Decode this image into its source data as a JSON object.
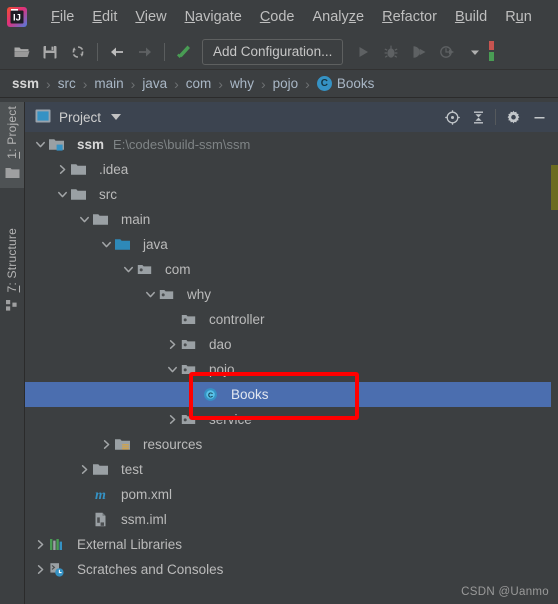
{
  "app": {
    "name": "IntelliJ IDEA",
    "logo_icon": "intellij-idea-logo"
  },
  "menubar": {
    "items": [
      {
        "label": "File",
        "mnemonic_index": 0
      },
      {
        "label": "Edit",
        "mnemonic_index": 0
      },
      {
        "label": "View",
        "mnemonic_index": 0
      },
      {
        "label": "Navigate",
        "mnemonic_index": 0
      },
      {
        "label": "Code",
        "mnemonic_index": 0
      },
      {
        "label": "Analyze",
        "mnemonic_index": 5
      },
      {
        "label": "Refactor",
        "mnemonic_index": 0
      },
      {
        "label": "Build",
        "mnemonic_index": 0
      },
      {
        "label": "Run",
        "mnemonic_index": 1
      }
    ]
  },
  "toolbar": {
    "open_icon": "open-folder-icon",
    "save_icon": "save-icon",
    "sync_icon": "sync-refresh-icon",
    "back_icon": "arrow-back-icon",
    "forward_icon": "arrow-forward-icon",
    "build_icon": "build-hammer-icon",
    "run_config_label": "Add Configuration...",
    "run_icon": "run-play-icon",
    "debug_icon": "debug-bug-icon",
    "coverage_icon": "run-with-coverage-icon",
    "profile_icon": "profiler-icon",
    "more_icon": "chevron-down-icon"
  },
  "breadcrumb": {
    "separator": "›",
    "items": [
      {
        "label": "ssm",
        "bold": true,
        "icon": null
      },
      {
        "label": "src",
        "bold": false,
        "icon": null
      },
      {
        "label": "main",
        "bold": false,
        "icon": null
      },
      {
        "label": "java",
        "bold": false,
        "icon": null
      },
      {
        "label": "com",
        "bold": false,
        "icon": null
      },
      {
        "label": "why",
        "bold": false,
        "icon": null
      },
      {
        "label": "pojo",
        "bold": false,
        "icon": null
      },
      {
        "label": "Books",
        "bold": false,
        "icon": "java-class-icon",
        "icon_letter": "C"
      }
    ]
  },
  "stripe": {
    "tabs": [
      {
        "label": "1: Project",
        "mnemonic": "1",
        "icon": "project-folder-icon",
        "active": true
      },
      {
        "label": "7: Structure",
        "mnemonic": "7",
        "icon": "structure-icon",
        "active": false
      }
    ]
  },
  "tool_window": {
    "title": "Project",
    "view_icon": "project-view-icon",
    "dropdown_icon": "chevron-down-icon",
    "actions": [
      {
        "name": "scroll-from-source-icon",
        "label": "Select Opened File"
      },
      {
        "name": "collapse-all-icon",
        "label": "Collapse All"
      },
      {
        "name": "gear-icon",
        "label": "Settings"
      },
      {
        "name": "minimize-icon",
        "label": "Hide"
      }
    ]
  },
  "tree": {
    "rows": [
      {
        "label": "ssm",
        "path": "E:\\codes\\build-ssm\\ssm",
        "depth": 0,
        "arrow": "expanded",
        "icon": "module-folder-icon",
        "bold": true,
        "selected": false
      },
      {
        "label": ".idea",
        "path": "",
        "depth": 1,
        "arrow": "collapsed",
        "icon": "folder-icon",
        "bold": false,
        "selected": false
      },
      {
        "label": "src",
        "path": "",
        "depth": 1,
        "arrow": "expanded",
        "icon": "folder-icon",
        "bold": false,
        "selected": false
      },
      {
        "label": "main",
        "path": "",
        "depth": 2,
        "arrow": "expanded",
        "icon": "folder-icon",
        "bold": false,
        "selected": false
      },
      {
        "label": "java",
        "path": "",
        "depth": 3,
        "arrow": "expanded",
        "icon": "source-root-icon",
        "bold": false,
        "selected": false
      },
      {
        "label": "com",
        "path": "",
        "depth": 4,
        "arrow": "expanded",
        "icon": "package-icon",
        "bold": false,
        "selected": false
      },
      {
        "label": "why",
        "path": "",
        "depth": 5,
        "arrow": "expanded",
        "icon": "package-icon",
        "bold": false,
        "selected": false
      },
      {
        "label": "controller",
        "path": "",
        "depth": 6,
        "arrow": "none",
        "icon": "package-icon",
        "bold": false,
        "selected": false
      },
      {
        "label": "dao",
        "path": "",
        "depth": 6,
        "arrow": "collapsed",
        "icon": "package-icon",
        "bold": false,
        "selected": false
      },
      {
        "label": "pojo",
        "path": "",
        "depth": 6,
        "arrow": "expanded",
        "icon": "package-icon",
        "bold": false,
        "selected": false
      },
      {
        "label": "Books",
        "path": "",
        "depth": 7,
        "arrow": "none",
        "icon": "java-class-icon",
        "bold": false,
        "selected": true
      },
      {
        "label": "service",
        "path": "",
        "depth": 6,
        "arrow": "collapsed",
        "icon": "package-icon",
        "bold": false,
        "selected": false
      },
      {
        "label": "resources",
        "path": "",
        "depth": 3,
        "arrow": "collapsed",
        "icon": "resource-root-icon",
        "bold": false,
        "selected": false
      },
      {
        "label": "test",
        "path": "",
        "depth": 2,
        "arrow": "collapsed",
        "icon": "folder-icon",
        "bold": false,
        "selected": false
      },
      {
        "label": "pom.xml",
        "path": "",
        "depth": 2,
        "arrow": "none",
        "icon": "maven-pom-icon",
        "bold": false,
        "selected": false
      },
      {
        "label": "ssm.iml",
        "path": "",
        "depth": 2,
        "arrow": "none",
        "icon": "iml-module-icon",
        "bold": false,
        "selected": false
      },
      {
        "label": "External Libraries",
        "path": "",
        "depth": 0,
        "arrow": "collapsed",
        "icon": "libraries-icon",
        "bold": false,
        "selected": false
      },
      {
        "label": "Scratches and Consoles",
        "path": "",
        "depth": 0,
        "arrow": "collapsed",
        "icon": "scratches-icon",
        "bold": false,
        "selected": false
      }
    ]
  },
  "annotation": {
    "shape": "rectangle",
    "color": "#ff0000",
    "target_label": "Books"
  },
  "watermark": {
    "text": "CSDN @Uanmo"
  },
  "colors": {
    "background": "#3c3f41",
    "panel_header": "#3c4450",
    "selection": "#4b6eaf",
    "text": "#bbbbbb",
    "accent_blue": "#3592c4",
    "source_root": "#2e89b8",
    "annotation_red": "#ff0000",
    "marker_yellow": "#6b6b20"
  }
}
